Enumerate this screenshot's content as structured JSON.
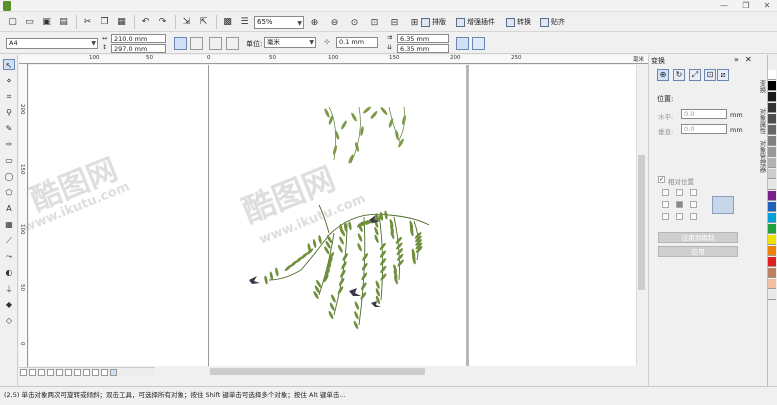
{
  "window": {
    "minimize": "—",
    "restore": "❐",
    "close": "✕"
  },
  "toolbar": {
    "zoom_value": "65%",
    "menus": [
      {
        "label": "排版"
      },
      {
        "label": "增强插件"
      },
      {
        "label": "转换"
      },
      {
        "label": "贴齐"
      }
    ]
  },
  "properties": {
    "page_size": "A4",
    "width": "210.0 mm",
    "height": "297.0 mm",
    "units_label": "单位:",
    "units_value": "毫米",
    "nudge": "0.1 mm",
    "dup_x": "6.35 mm",
    "dup_y": "6.35 mm"
  },
  "ruler_top_ticks": [
    "100",
    "50",
    "0",
    "50",
    "100",
    "150",
    "200",
    "250",
    "毫米"
  ],
  "ruler_left_ticks": [
    "200",
    "150",
    "100",
    "50",
    "0"
  ],
  "docker": {
    "title": "变换",
    "position_label": "位置:",
    "h_label": "水平:",
    "h_value": "0.0",
    "v_label": "垂直:",
    "v_value": "0.0",
    "unit": "mm",
    "relative_label": "相对位置",
    "apply_copy_label": "应用到再制",
    "apply_label": "应用",
    "side_tabs": [
      "变换",
      "对象属性",
      "对象管理器"
    ]
  },
  "status_text": "(2,5) 单击对象两次可旋转或倾斜；双击工具，可选择所有对象；按住 Shift 键单击可选择多个对象；按住 Alt 键单击...",
  "watermark": {
    "cn": "酷图网",
    "url": "www.ikutu.com"
  },
  "palette_colors": [
    "#ffffff",
    "#000000",
    "#1a1a1a",
    "#333333",
    "#4d4d4d",
    "#666666",
    "#808080",
    "#999999",
    "#b3b3b3",
    "#cccccc",
    "#e6e6e6",
    "#7a1e8c",
    "#2060c0",
    "#00a0e0",
    "#20a040",
    "#f0e000",
    "#f08000",
    "#e02020",
    "#c08060",
    "#f0c0a0",
    "#e8e8e8"
  ],
  "colors": {
    "leaf": "#6f8f3a",
    "leaf_dark": "#4e6b2a",
    "bird": "#3a3a4a",
    "accent": "#cfe0f7"
  }
}
